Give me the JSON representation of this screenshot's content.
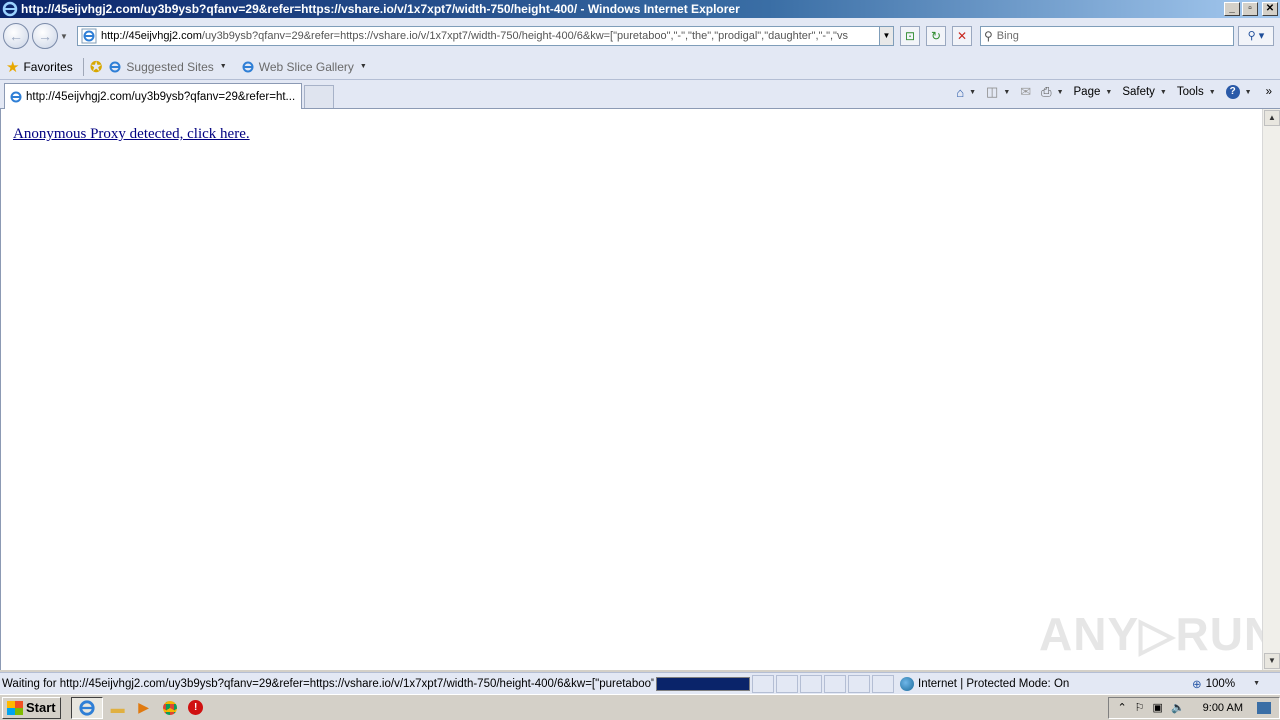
{
  "window": {
    "title": "http://45eijvhgj2.com/uy3b9ysb?qfanv=29&refer=https://vshare.io/v/1x7xpt7/width-750/height-400/ - Windows Internet Explorer",
    "btn_min": "_",
    "btn_max": "▫",
    "btn_close": "✕"
  },
  "nav": {
    "back_glyph": "←",
    "forward_glyph": "→",
    "dropdown_glyph": "▼",
    "address_domain": "http://45eijvhgj2.com",
    "address_rest": "/uy3b9ysb?qfanv=29&refer=https://vshare.io/v/1x7xpt7/width-750/height-400/6&kw=[\"puretaboo\",\"-\",\"the\",\"prodigal\",\"daughter\",\"-\",\"vs",
    "compat_glyph": "⊡",
    "refresh_glyph": "↻",
    "stop_glyph": "✕",
    "search_placeholder": "Bing",
    "search_glyph": "⚲ ▾"
  },
  "favorites": {
    "label": "Favorites",
    "suggested": "Suggested Sites",
    "web_slice": "Web Slice Gallery"
  },
  "tab": {
    "label": "http://45eijvhgj2.com/uy3b9ysb?qfanv=29&refer=ht..."
  },
  "commands": {
    "home_glyph": "⌂",
    "feeds_glyph": "◫",
    "mail_glyph": "✉",
    "print_glyph": "⎙",
    "page": "Page",
    "safety": "Safety",
    "tools": "Tools",
    "help_glyph": "?",
    "more_glyph": "»"
  },
  "page": {
    "proxy_link": "Anonymous Proxy detected, click here.",
    "watermark": "ANY▷RUN"
  },
  "scroll": {
    "up_glyph": "▲",
    "down_glyph": "▼"
  },
  "status": {
    "text": "Waiting for http://45eijvhgj2.com/uy3b9ysb?qfanv=29&refer=https://vshare.io/v/1x7xpt7/width-750/height-400/6&kw=[\"puretaboo\",",
    "progress": 1.0,
    "zone": "Internet | Protected Mode: On",
    "zoom_glyph": "⊕",
    "zoom": "100%"
  },
  "taskbar": {
    "start": "Start",
    "clock": "9:00 AM",
    "tray_chevron": "⌃",
    "tray_flag": "⚐",
    "tray_net": "▣",
    "tray_vol": "🔈"
  },
  "colors": {
    "link": "#000080",
    "titlebar": "#0a246a",
    "progress": "#0a246a"
  }
}
